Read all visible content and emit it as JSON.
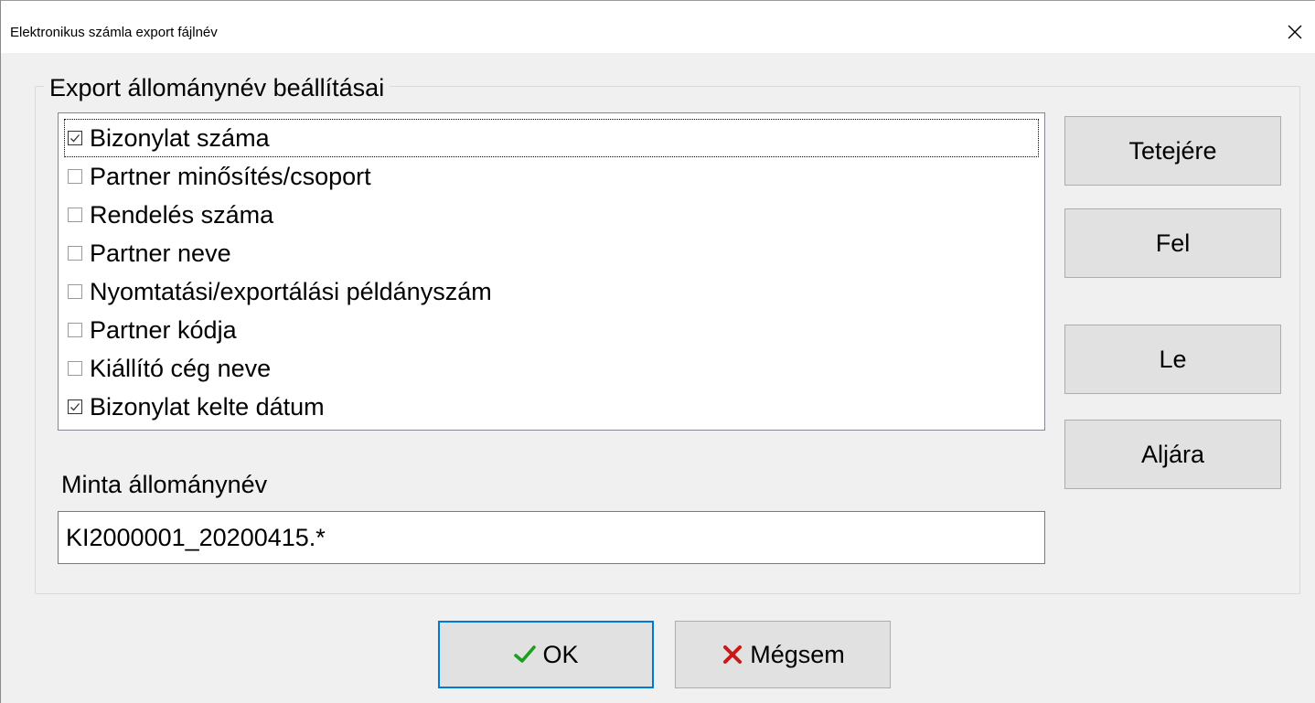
{
  "window": {
    "title": "Elektronikus számla export fájlnév"
  },
  "group": {
    "title": "Export állománynév beállításai"
  },
  "list": {
    "items": [
      {
        "label": "Bizonylat száma",
        "checked": true,
        "focused": true
      },
      {
        "label": "Partner minősítés/csoport",
        "checked": false
      },
      {
        "label": "Rendelés száma",
        "checked": false
      },
      {
        "label": "Partner neve",
        "checked": false
      },
      {
        "label": "Nyomtatási/exportálási példányszám",
        "checked": false
      },
      {
        "label": "Partner kódja",
        "checked": false
      },
      {
        "label": "Kiállító cég neve",
        "checked": false
      },
      {
        "label": "Bizonylat kelte dátum",
        "checked": true
      }
    ]
  },
  "side_buttons": {
    "top": "Tetejére",
    "up": "Fel",
    "down": "Le",
    "bottom": "Aljára"
  },
  "sample": {
    "label": "Minta állománynév",
    "value": "KI2000001_20200415.*"
  },
  "footer": {
    "ok_label": "OK",
    "cancel_label": "Mégsem"
  },
  "icons": {
    "close": "close-icon",
    "ok": "checkmark-icon",
    "cancel": "x-mark-icon",
    "checked": "checkbox-checked-icon",
    "unchecked": "checkbox-unchecked-icon"
  },
  "colors": {
    "ok_icon": "#1aa01a",
    "cancel_icon": "#c81818",
    "default_button_border": "#0078d7"
  }
}
